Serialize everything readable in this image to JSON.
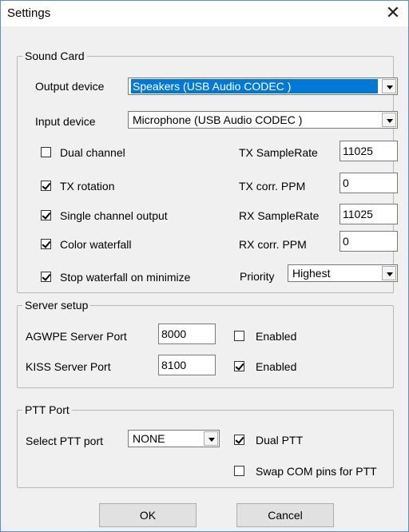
{
  "window": {
    "title": "Settings",
    "close_glyph": "✕"
  },
  "sound_card": {
    "legend": "Sound Card",
    "output_label": "Output device",
    "output_value": "Speakers (USB Audio CODEC )",
    "input_label": "Input device",
    "input_value": "Microphone (USB Audio CODEC )",
    "checkboxes": [
      {
        "label": "Dual channel",
        "checked": false
      },
      {
        "label": "TX rotation",
        "checked": true
      },
      {
        "label": "Single channel output",
        "checked": true
      },
      {
        "label": "Color waterfall",
        "checked": true
      },
      {
        "label": "Stop waterfall on minimize",
        "checked": true
      }
    ],
    "tx_samplerate_label": "TX SampleRate",
    "tx_samplerate_value": "11025",
    "tx_ppm_label": "TX corr. PPM",
    "tx_ppm_value": "0",
    "rx_samplerate_label": "RX SampleRate",
    "rx_samplerate_value": "11025",
    "rx_ppm_label": "RX corr. PPM",
    "rx_ppm_value": "0",
    "priority_label": "Priority",
    "priority_value": "Highest"
  },
  "server_setup": {
    "legend": "Server setup",
    "agwpe_label": "AGWPE Server Port",
    "agwpe_value": "8000",
    "agwpe_enabled_label": "Enabled",
    "agwpe_enabled": false,
    "kiss_label": "KISS Server Port",
    "kiss_value": "8100",
    "kiss_enabled_label": "Enabled",
    "kiss_enabled": true
  },
  "ptt_port": {
    "legend": "PTT Port",
    "select_label": "Select PTT port",
    "select_value": "NONE",
    "dual_ptt_label": "Dual PTT",
    "dual_ptt": true,
    "swap_label": "Swap COM pins for PTT",
    "swap": false
  },
  "buttons": {
    "ok": "OK",
    "cancel": "Cancel"
  },
  "colors": {
    "accent": "#0078d7",
    "window_border": "#5b8fd4"
  }
}
